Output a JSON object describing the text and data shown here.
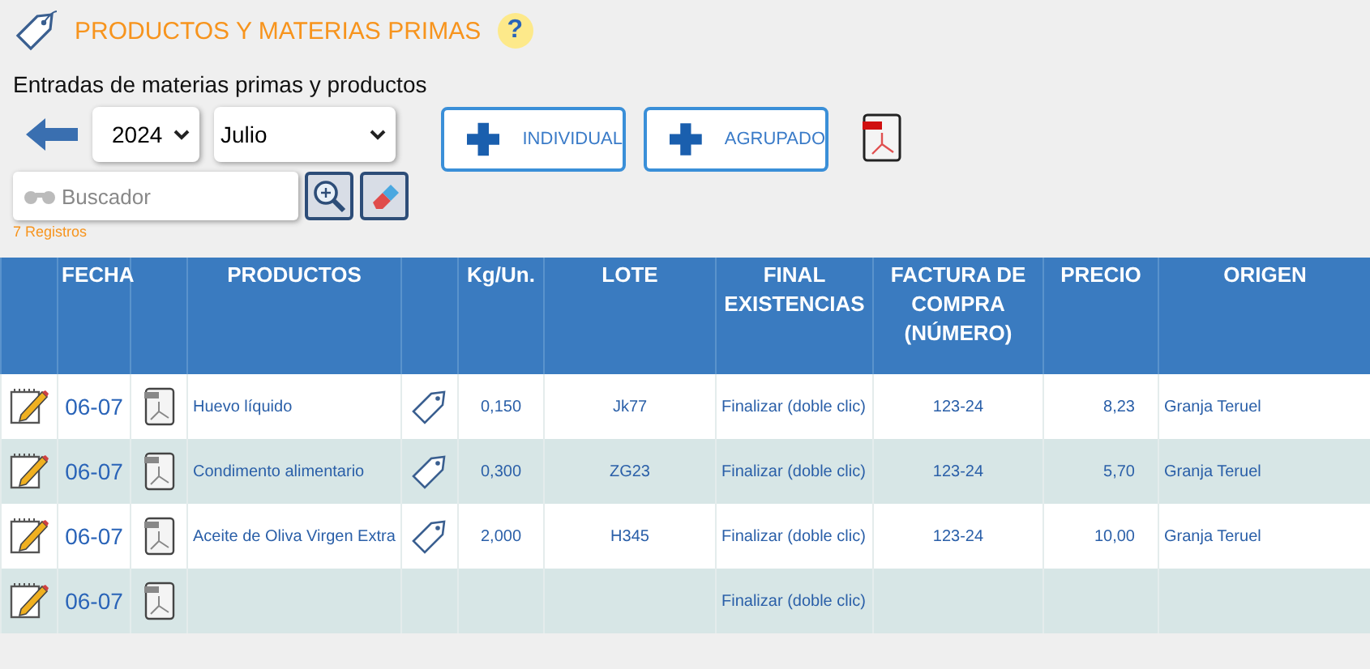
{
  "header": {
    "title": "PRODUCTOS Y MATERIAS PRIMAS",
    "help": "?"
  },
  "subtitle": "Entradas de materias primas y productos",
  "filters": {
    "year": "2024",
    "month": "Julio",
    "search_placeholder": "Buscador"
  },
  "buttons": [
    {
      "label": "INDIVIDUAL"
    },
    {
      "label": "AGRUPADO"
    }
  ],
  "record_count": "7 Registros",
  "table": {
    "columns": [
      "",
      "FECHA",
      "",
      "PRODUCTOS",
      "",
      "Kg/Un.",
      "LOTE",
      "FINAL EXISTENCIAS",
      "FACTURA DE COMPRA (NÚMERO)",
      "PRECIO",
      "ORIGEN"
    ],
    "rows": [
      {
        "fecha": "06-07",
        "producto": "Huevo líquido",
        "labeled": true,
        "kg": "0,150",
        "lote": "Jk77",
        "final": "Finalizar (doble clic)",
        "factura": "123-24",
        "precio": "8,23",
        "origen": "Granja Teruel"
      },
      {
        "fecha": "06-07",
        "producto": "Condimento alimentario",
        "labeled": true,
        "kg": "0,300",
        "lote": "ZG23",
        "final": "Finalizar (doble clic)",
        "factura": "123-24",
        "precio": "5,70",
        "origen": "Granja Teruel"
      },
      {
        "fecha": "06-07",
        "producto": "Aceite de Oliva Virgen Extra",
        "labeled": true,
        "kg": "2,000",
        "lote": "H345",
        "final": "Finalizar (doble clic)",
        "factura": "123-24",
        "precio": "10,00",
        "origen": "Granja Teruel"
      },
      {
        "fecha": "06-07",
        "labeled": false,
        "final": "Finalizar (doble clic)"
      }
    ]
  }
}
